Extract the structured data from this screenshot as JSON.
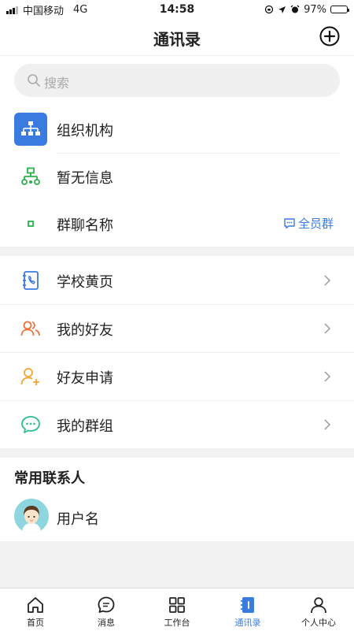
{
  "status": {
    "carrier": "中国移动",
    "network": "4G",
    "time": "14:58",
    "battery": "97%",
    "battery_level": 0.97
  },
  "nav": {
    "title": "通讯录",
    "add_icon": "plus-circle-icon"
  },
  "search": {
    "placeholder": "搜索"
  },
  "org": {
    "items": [
      {
        "label": "组织机构",
        "icon": "org-chart-icon"
      },
      {
        "label": "暂无信息",
        "icon": "hierarchy-icon"
      },
      {
        "label": "群聊名称",
        "icon": "dot-icon",
        "tag": "全员群"
      }
    ]
  },
  "menu": {
    "items": [
      {
        "label": "学校黄页",
        "icon": "phonebook-icon"
      },
      {
        "label": "我的好友",
        "icon": "friends-icon"
      },
      {
        "label": "好友申请",
        "icon": "add-friend-icon"
      },
      {
        "label": "我的群组",
        "icon": "group-chat-icon"
      }
    ]
  },
  "frequent": {
    "title": "常用联系人",
    "contacts": [
      {
        "name": "用户名",
        "icon": "avatar"
      }
    ]
  },
  "tabs": [
    {
      "label": "首页",
      "icon": "home-icon"
    },
    {
      "label": "消息",
      "icon": "message-icon"
    },
    {
      "label": "工作台",
      "icon": "grid-icon"
    },
    {
      "label": "通讯录",
      "icon": "contacts-book-icon",
      "active": true
    },
    {
      "label": "个人中心",
      "icon": "user-icon"
    }
  ],
  "colors": {
    "accent": "#3a7be0",
    "green": "#2bb24c",
    "orange": "#f0703a",
    "amber": "#f2a534",
    "teal": "#2bc08a"
  }
}
